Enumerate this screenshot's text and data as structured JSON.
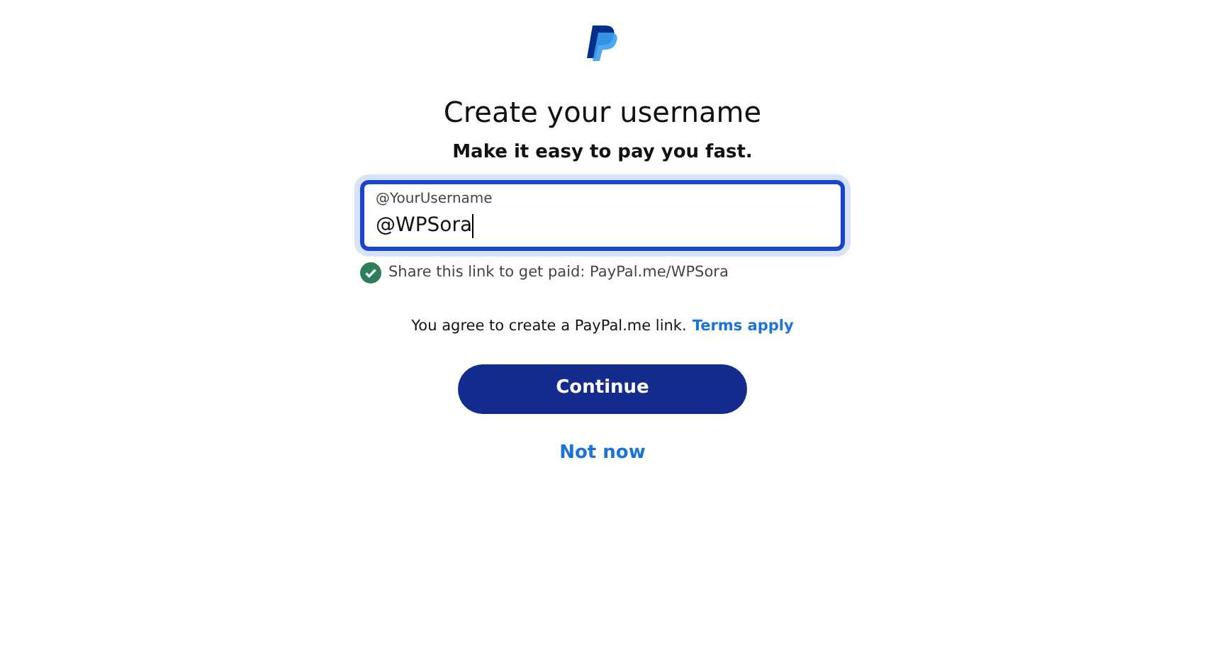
{
  "title": "Create your username",
  "subtitle": "Make it easy to pay you fast.",
  "username_field": {
    "label": "@YourUsername",
    "value": "@WPSora",
    "focused": true
  },
  "helper": {
    "valid": true,
    "text": "Share this link to get paid: PayPal.me/WPSora"
  },
  "agreement": {
    "text": "You agree to create a PayPal.me link.",
    "link": "Terms apply"
  },
  "buttons": {
    "primary": "Continue",
    "secondary": "Not now"
  }
}
